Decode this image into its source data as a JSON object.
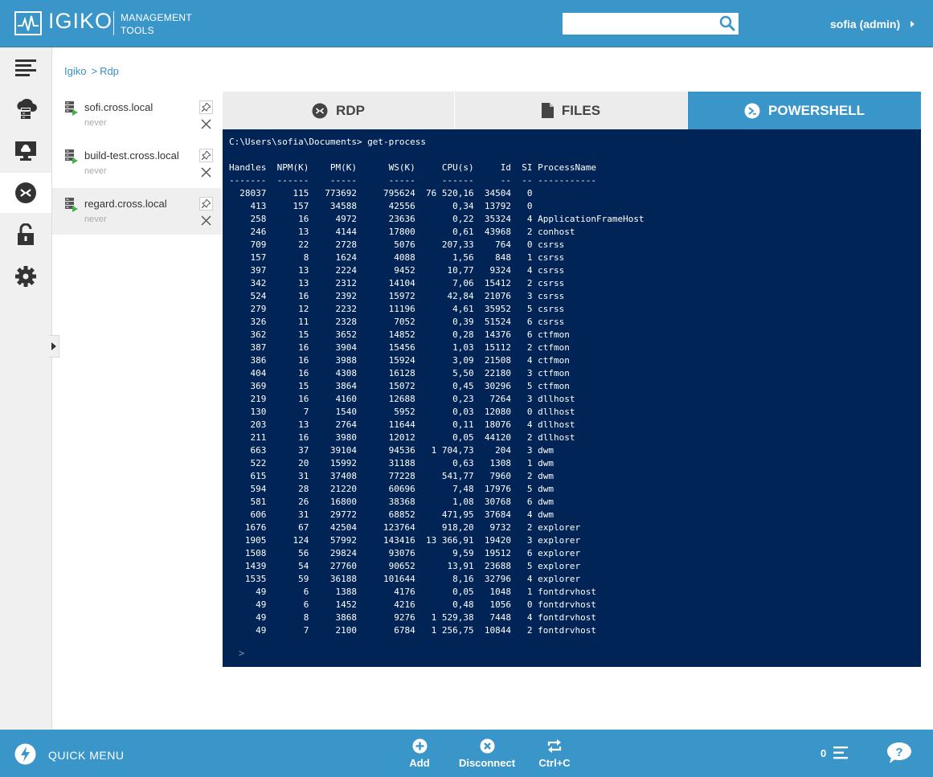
{
  "header": {
    "brand": "IGIKO",
    "subtitle_line1": "MANAGEMENT",
    "subtitle_line2": "TOOLS",
    "search": {
      "value": "",
      "placeholder": ""
    },
    "user": "sofia (admin)"
  },
  "sidebar": {
    "items": [
      {
        "name": "menu",
        "icon": "hamburger-icon"
      },
      {
        "name": "cloud-server",
        "icon": "cloud-server-icon"
      },
      {
        "name": "remote-desktop",
        "icon": "monitor-cloud-icon"
      },
      {
        "name": "rdp",
        "icon": "rdp-icon",
        "active": true
      },
      {
        "name": "unlock",
        "icon": "unlock-icon"
      },
      {
        "name": "settings",
        "icon": "gear-icon"
      }
    ]
  },
  "breadcrumb": [
    "Igiko",
    "Rdp"
  ],
  "connections": [
    {
      "name": "sofi.cross.local",
      "status": "never",
      "active": false
    },
    {
      "name": "build-test.cross.local",
      "status": "never",
      "active": false
    },
    {
      "name": "regard.cross.local",
      "status": "never",
      "active": true
    }
  ],
  "tabs": [
    {
      "label": "RDP",
      "icon": "rdp-icon",
      "active": false
    },
    {
      "label": "FILES",
      "icon": "file-icon",
      "active": false
    },
    {
      "label": "POWERSHELL",
      "icon": "powershell-icon",
      "active": true
    }
  ],
  "terminal": {
    "output": "C:\\Users\\sofia\\Documents> get-process\n\nHandles  NPM(K)    PM(K)      WS(K)     CPU(s)     Id  SI ProcessName\n-------  ------    -----      -----     ------     --  -- -----------\n  28037     115   773692     795624  76 520,16  34504   0\n    413     157    34588      42556       0,34  13792   0\n    258      16     4972      23636       0,22  35324   4 ApplicationFrameHost\n    246      13     4144      17800       0,61  43968   2 conhost\n    709      22     2728       5076     207,33    764   0 csrss\n    157       8     1624       4088       1,56    848   1 csrss\n    397      13     2224       9452      10,77   9324   4 csrss\n    342      13     2312      14104       7,06  15412   2 csrss\n    524      16     2392      15972      42,84  21076   3 csrss\n    279      12     2232      11196       4,61  35952   5 csrss\n    326      11     2328       7052       0,39  51524   6 csrss\n    362      15     3652      14852       0,28  14376   6 ctfmon\n    387      16     3904      15456       1,03  15112   2 ctfmon\n    386      16     3988      15924       3,09  21508   4 ctfmon\n    404      16     4308      16128       5,50  22180   3 ctfmon\n    369      15     3864      15072       0,45  30296   5 ctfmon\n    219      16     4160      12688       0,23   7264   3 dllhost\n    130       7     1540       5952       0,03  12080   0 dllhost\n    203      13     2764      11644       0,11  18076   4 dllhost\n    211      16     3980      12012       0,05  44120   2 dllhost\n    663      37    39104      94536   1 704,73    204   3 dwm\n    522      20    15992      31188       0,63   1308   1 dwm\n    615      31    37408      77228     541,77   7960   2 dwm\n    594      28    21220      60696       7,48  17976   5 dwm\n    581      26    16800      38368       1,08  30768   6 dwm\n    606      31    29772      68852     471,95  37684   4 dwm\n   1676      67    42504     123764     918,20   9732   2 explorer\n   1905     124    57992     143416  13 366,91  19420   3 explorer\n   1508      56    29824      93076       9,59  19512   6 explorer\n   1439      54    27760      90652      13,91  23688   5 explorer\n   1535      59    36188     101644       8,16  32796   4 explorer\n     49       6     1388       4176       0,05   1048   1 fontdrvhost\n     49       6     1452       4216       0,48   1056   0 fontdrvhost\n     49       8     3868       9276   1 529,38   7448   4 fontdrvhost\n     49       7     2100       6784   1 256,75  10844   2 fontdrvhost",
    "prompt": ">"
  },
  "footer": {
    "quick_menu": "QUICK MENU",
    "buttons": [
      {
        "label": "Add",
        "icon": "plus-circle-icon"
      },
      {
        "label": "Disconnect",
        "icon": "x-circle-icon"
      },
      {
        "label": "Ctrl+C",
        "icon": "repeat-icon"
      }
    ],
    "count": "0"
  },
  "colors": {
    "primary": "#3a96c9",
    "terminal_bg": "#012456",
    "link": "#3a8ec1"
  }
}
